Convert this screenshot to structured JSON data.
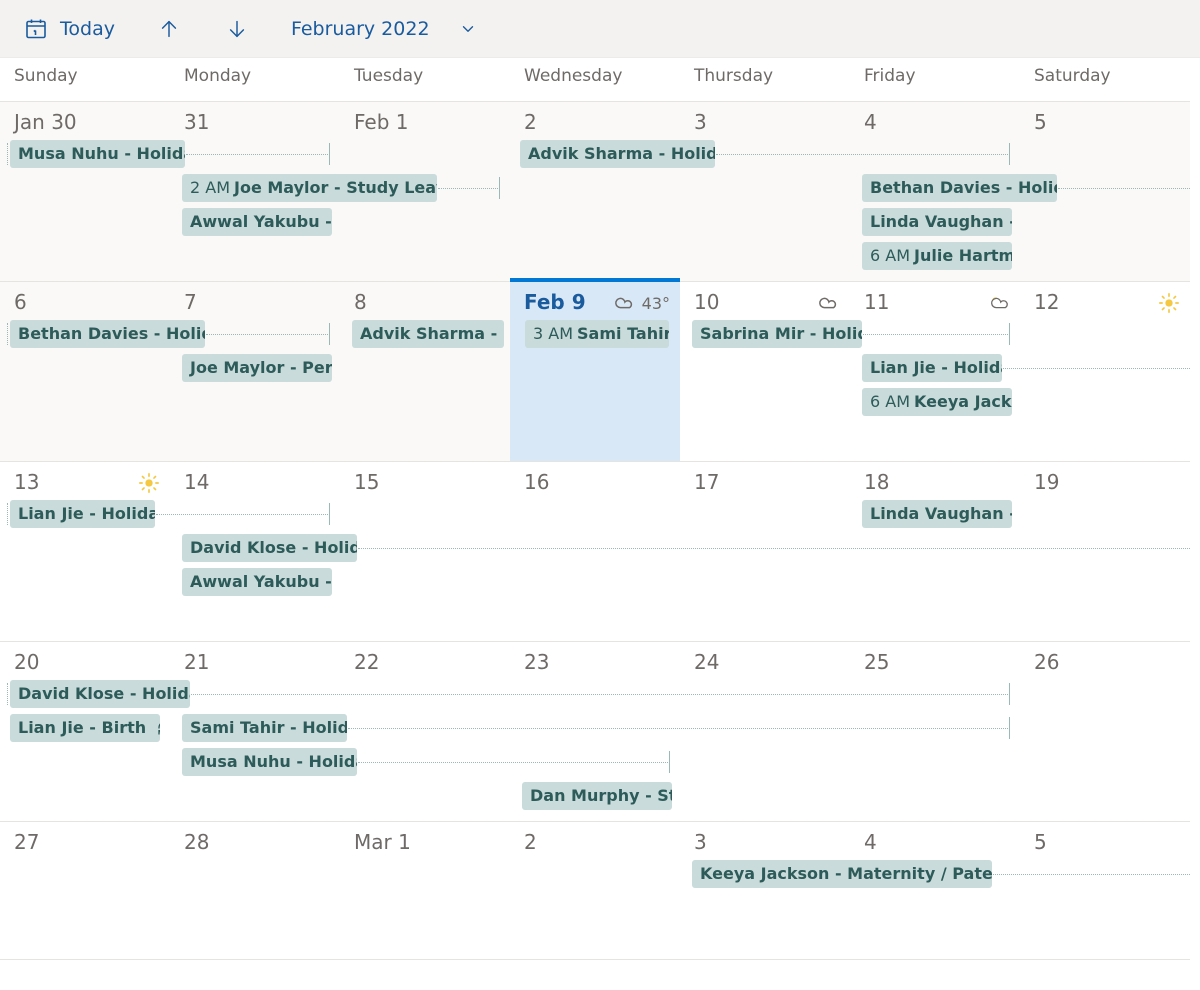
{
  "toolbar": {
    "today_label": "Today",
    "month_label": "February 2022"
  },
  "dow": [
    "Sunday",
    "Monday",
    "Tuesday",
    "Wednesday",
    "Thursday",
    "Friday",
    "Saturday"
  ],
  "weeks": [
    {
      "days": [
        {
          "label": "Jan 30",
          "past": true
        },
        {
          "label": "31",
          "past": true
        },
        {
          "label": "Feb 1",
          "past": true
        },
        {
          "label": "2",
          "past": true
        },
        {
          "label": "3",
          "past": true
        },
        {
          "label": "4",
          "past": true
        },
        {
          "label": "5",
          "past": true
        }
      ]
    },
    {
      "days": [
        {
          "label": "6",
          "past": true
        },
        {
          "label": "7",
          "past": true
        },
        {
          "label": "8",
          "past": true
        },
        {
          "label": "Feb 9",
          "today": true,
          "wx": "cloud",
          "temp": "43°"
        },
        {
          "label": "10",
          "wx": "cloud"
        },
        {
          "label": "11",
          "wx": "partly"
        },
        {
          "label": "12",
          "wx": "sun"
        }
      ]
    },
    {
      "days": [
        {
          "label": "13",
          "wx": "sun"
        },
        {
          "label": "14"
        },
        {
          "label": "15"
        },
        {
          "label": "16"
        },
        {
          "label": "17"
        },
        {
          "label": "18"
        },
        {
          "label": "19"
        }
      ]
    },
    {
      "days": [
        {
          "label": "20"
        },
        {
          "label": "21"
        },
        {
          "label": "22"
        },
        {
          "label": "23"
        },
        {
          "label": "24"
        },
        {
          "label": "25"
        },
        {
          "label": "26"
        }
      ]
    },
    {
      "days": [
        {
          "label": "27"
        },
        {
          "label": "28"
        },
        {
          "label": "Mar 1"
        },
        {
          "label": "2"
        },
        {
          "label": "3"
        },
        {
          "label": "4"
        },
        {
          "label": "5"
        }
      ]
    }
  ],
  "events": {
    "w0": {
      "musa": "Musa Nuhu - Holiday",
      "joe_time": "2 AM",
      "joe": "Joe Maylor - Study Leave",
      "awwal": "Awwal Yakubu - C",
      "advik": "Advik Sharma - Holiday",
      "bethan": "Bethan Davies - Holiday",
      "linda": "Linda Vaughan - T",
      "julie_time": "6 AM",
      "julie": "Julie Hartma"
    },
    "w1": {
      "bethan": "Bethan Davies - Holiday",
      "joe": "Joe Maylor - Perso",
      "advik": "Advik Sharma - Pe",
      "sami_time": "3 AM",
      "sami": "Sami Tahir -",
      "sabrina": "Sabrina Mir - Holiday",
      "lian": "Lian Jie - Holiday",
      "keeya_time": "6 AM",
      "keeya": "Keeya Jacks"
    },
    "w2": {
      "lian": "Lian Jie - Holiday",
      "david": "David Klose - Holiday",
      "awwal": "Awwal Yakubu - Tr",
      "linda": "Linda Vaughan - C"
    },
    "w3": {
      "david": "David Klose - Holiday",
      "lian": "Lian Jie - Birth",
      "sami": "Sami Tahir - Holiday",
      "musa": "Musa Nuhu - Holiday",
      "dan": "Dan Murphy - Stu"
    },
    "w4": {
      "keeya": "Keeya Jackson - Maternity / Paternity"
    }
  }
}
